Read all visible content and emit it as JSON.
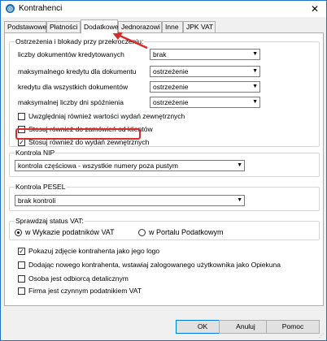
{
  "window": {
    "title": "Kontrahenci"
  },
  "tabs": [
    "Podstawowe",
    "Płatności",
    "Dodatkowe",
    "Jednorazowi",
    "Inne",
    "JPK VAT"
  ],
  "limits": {
    "legend": "Ostrzeżenia i blokady przy przekroczeniu:",
    "rows": [
      {
        "label": "liczby dokumentów kredytowanych",
        "value": "brak"
      },
      {
        "label": "maksymalnego kredytu dla  dokumentu",
        "value": "ostrzeżenie"
      },
      {
        "label": "kredytu dla wszystkich dokumentów",
        "value": "ostrzeżenie"
      },
      {
        "label": "maksymalnej liczby dni spóźnienia",
        "value": "ostrzeżenie"
      }
    ],
    "checkboxes": [
      {
        "label": "Uwzględniaj również wartości wydań zewnętrznych",
        "checked": false
      },
      {
        "label": "Stosuj również do zamówień od klientów",
        "checked": false
      },
      {
        "label": "Stosuj również do wydań zewnętrznych",
        "checked": true
      }
    ]
  },
  "nip": {
    "legend": "Kontrola NIP",
    "value": "kontrola częściowa - wszystkie numery poza pustym"
  },
  "pesel": {
    "legend": "Kontrola PESEL",
    "value": "brak kontroli"
  },
  "vat": {
    "legend": "Sprawdzaj status VAT:",
    "options": [
      "w Wykazie podatników VAT",
      "w Portalu Podatkowym"
    ],
    "selected": 0
  },
  "options": [
    {
      "label": "Pokazuj zdjęcie kontrahenta jako jego logo",
      "checked": true
    },
    {
      "label": "Dodając nowego kontrahenta, wstawiaj zalogowanego użytkownika jako Opiekuna",
      "checked": false
    },
    {
      "label": "Osoba jest odbiorcą detalicznym",
      "checked": false
    },
    {
      "label": "Firma jest czynnym podatnikiem VAT",
      "checked": false
    }
  ],
  "buttons": {
    "ok": "OK",
    "cancel": "Anuluj",
    "help": "Pomoc"
  },
  "icons": {
    "close": "✕",
    "dropdown": "▼",
    "check": "✓"
  },
  "colors": {
    "highlight": "#d62c2c",
    "accent": "#1d72c6"
  }
}
